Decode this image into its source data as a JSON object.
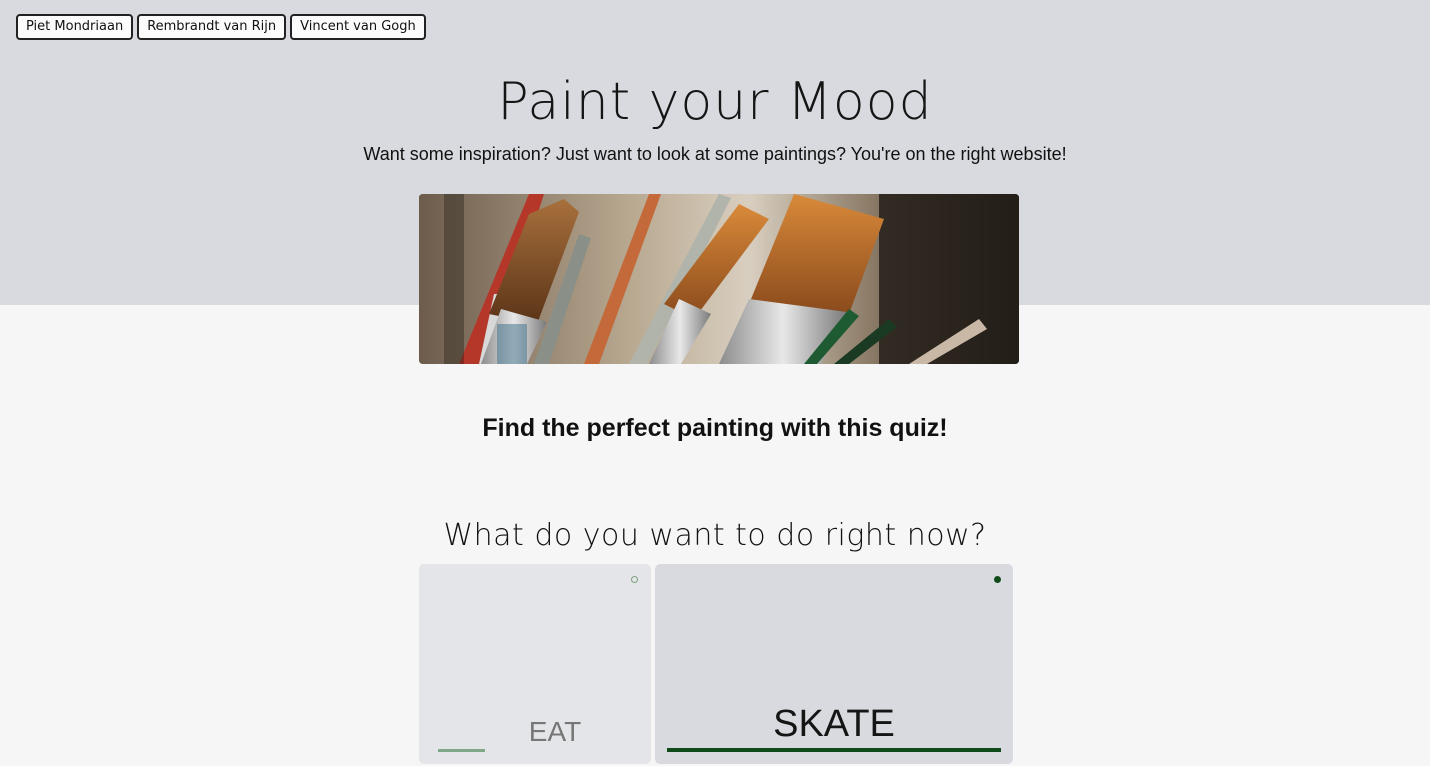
{
  "nav": {
    "items": [
      "Piet Mondriaan",
      "Rembrandt van Rijn",
      "Vincent van Gogh"
    ]
  },
  "header": {
    "title": "Paint your Mood",
    "subtitle": "Want some inspiration? Just want to look at some paintings? You're on the right website!"
  },
  "hero": {
    "alt": "paint brushes"
  },
  "quiz": {
    "intro": "Find the perfect painting with this quiz!",
    "question": "What do you want to do right now?",
    "options": [
      {
        "label": "EAT",
        "selected": false
      },
      {
        "label": "SKATE",
        "selected": true
      }
    ]
  },
  "colors": {
    "header_band": "#d8dadf",
    "page_background": "#f6f6f6",
    "accent_green": "#0f4a18",
    "light_green": "#7fa889"
  }
}
